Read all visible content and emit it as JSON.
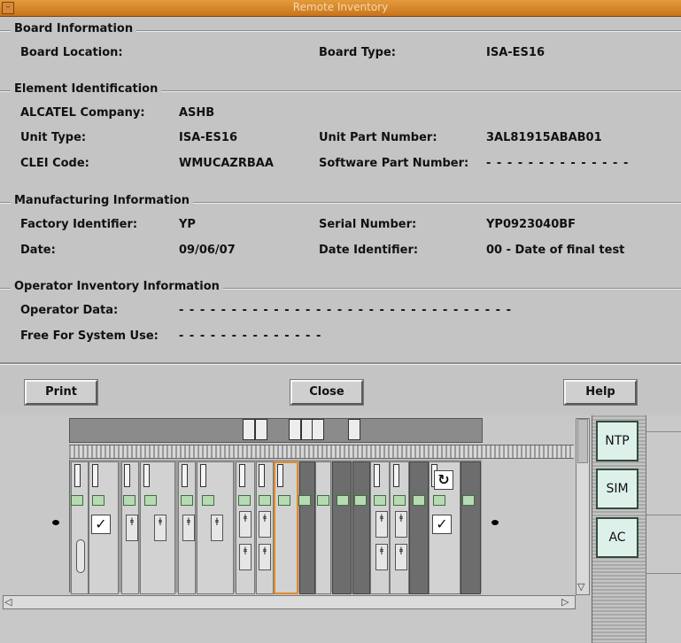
{
  "window": {
    "title": "Remote Inventory"
  },
  "board_information": {
    "legend": "Board Information",
    "location_label": "Board Location:",
    "location_value": "",
    "type_label": "Board Type:",
    "type_value": "ISA-ES16"
  },
  "element_identification": {
    "legend": "Element Identification",
    "company_label": "ALCATEL Company:",
    "company_value": "ASHB",
    "unit_type_label": "Unit Type:",
    "unit_type_value": "ISA-ES16",
    "unit_part_label": "Unit Part Number:",
    "unit_part_value": "3AL81915ABAB01",
    "clei_label": "CLEI Code:",
    "clei_value": "WMUCAZRBAA",
    "software_part_label": "Software Part Number:",
    "software_part_value": "- - - - - - - - - - - - - -"
  },
  "manufacturing_information": {
    "legend": "Manufacturing Information",
    "factory_label": "Factory Identifier:",
    "factory_value": "YP",
    "serial_label": "Serial Number:",
    "serial_value": "YP0923040BF",
    "date_label": "Date:",
    "date_value": "09/06/07",
    "date_id_label": "Date Identifier:",
    "date_id_value": "00 - Date of final test"
  },
  "operator_inventory": {
    "legend": "Operator Inventory Information",
    "operator_data_label": "Operator Data:",
    "operator_data_value": "- - - - - - - - - - - - - - - - - - - - - - - - - - - - - - - -",
    "free_label": "Free For System Use:",
    "free_value": "- - - - - - - - - - - - - -"
  },
  "buttons": {
    "print": "Print",
    "close": "Close",
    "help": "Help"
  },
  "shelf": {
    "side_buttons": [
      "NTP",
      "SIM",
      "AC"
    ],
    "icons": [
      "checkmark-icon",
      "refresh-icon",
      "fuse-icon",
      "led-indicator-icon"
    ]
  },
  "colors": {
    "title_bar": "#d6822e",
    "selection": "#e08a2c",
    "led_green": "#b6dbb4",
    "side_button": "#ddf1ea"
  }
}
